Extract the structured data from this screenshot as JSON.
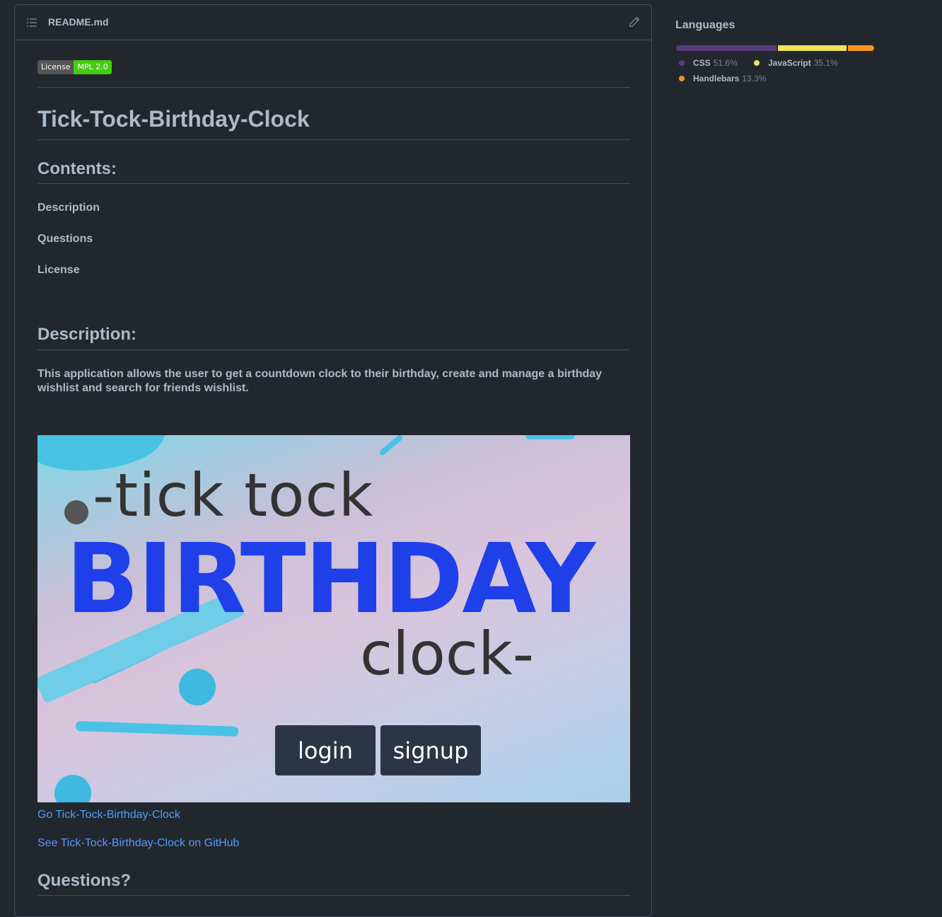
{
  "readme": {
    "filename": "README.md",
    "badge": {
      "left": "License",
      "right": "MPL 2.0"
    },
    "title": "Tick-Tock-Birthday-Clock",
    "contents_heading": "Contents:",
    "toc": [
      "Description",
      "Questions",
      "License"
    ],
    "description_heading": "Description:",
    "description_text": "This application allows the user to get a countdown clock to their birthday, create and manage a birthday wishlist and search for friends wishlist.",
    "hero": {
      "line1": "-tick tock",
      "line2": "BIRTHDAY",
      "line3": "clock-",
      "login": "login",
      "signup": "signup"
    },
    "links": [
      "Go Tick-Tock-Birthday-Clock",
      "See Tick-Tock-Birthday-Clock on GitHub"
    ],
    "questions_heading": "Questions?"
  },
  "sidebar": {
    "languages_title": "Languages",
    "languages": [
      {
        "name": "CSS",
        "percent": "51.6%",
        "color": "#563d7c",
        "share": 51.6
      },
      {
        "name": "JavaScript",
        "percent": "35.1%",
        "color": "#f1e05a",
        "share": 35.1
      },
      {
        "name": "Handlebars",
        "percent": "13.3%",
        "color": "#f7931e",
        "share": 13.3
      }
    ]
  }
}
